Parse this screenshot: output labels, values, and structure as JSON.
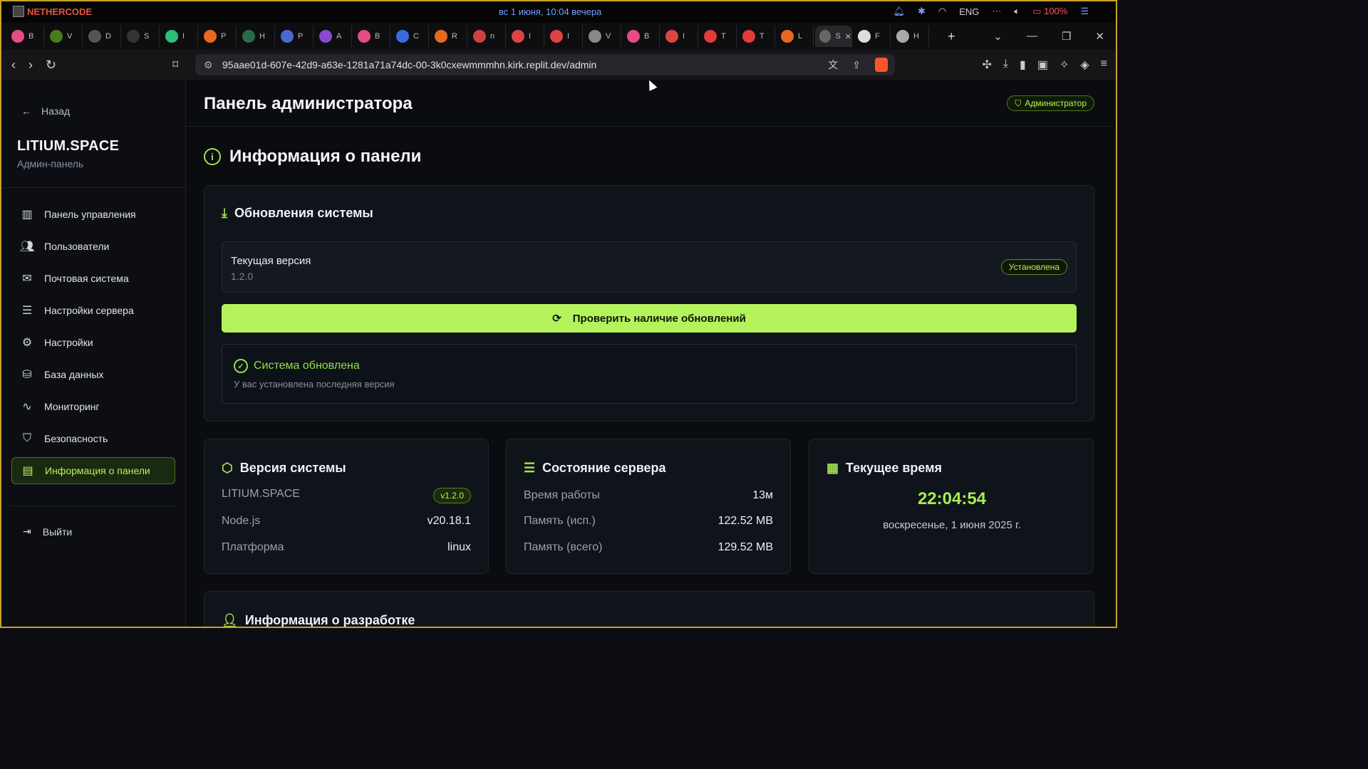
{
  "os": {
    "app_name": "NETHERCODE",
    "clock": "вс 1 июня, 10:04 вечера",
    "lang": "ENG",
    "battery": "100%"
  },
  "tabs": [
    {
      "label": "B",
      "color": "#e44d83"
    },
    {
      "label": "V",
      "color": "#4a7a20"
    },
    {
      "label": "D",
      "color": "#555"
    },
    {
      "label": "S",
      "color": "#333"
    },
    {
      "label": "I",
      "color": "#2bbf7a"
    },
    {
      "label": "P",
      "color": "#e86a1f"
    },
    {
      "label": "H",
      "color": "#2a6a4a"
    },
    {
      "label": "P",
      "color": "#4a6ad0"
    },
    {
      "label": "A",
      "color": "#8a4ad0"
    },
    {
      "label": "B",
      "color": "#e44d83"
    },
    {
      "label": "C",
      "color": "#3a6ae0"
    },
    {
      "label": "R",
      "color": "#e86a1f"
    },
    {
      "label": "n",
      "color": "#d04040"
    },
    {
      "label": "I",
      "color": "#d44"
    },
    {
      "label": "I",
      "color": "#d44"
    },
    {
      "label": "V",
      "color": "#888"
    },
    {
      "label": "B",
      "color": "#e44d83"
    },
    {
      "label": "I",
      "color": "#d44"
    },
    {
      "label": "T",
      "color": "#e23b3b"
    },
    {
      "label": "T",
      "color": "#e23b3b"
    },
    {
      "label": "L",
      "color": "#e86a1f"
    },
    {
      "label": "S",
      "color": "#666"
    },
    {
      "label": "F",
      "color": "#ddd"
    },
    {
      "label": "H",
      "color": "#aaa"
    }
  ],
  "browser": {
    "url": "95aae01d-607e-42d9-a63e-1281a71a74dc-00-3k0cxewmmmhn.kirk.replit.dev/admin"
  },
  "sidebar": {
    "back_label": "Назад",
    "brand": "LITIUM.SPACE",
    "brand_sub": "Админ-панель",
    "items": [
      {
        "label": "Панель управления",
        "icon": "bar-chart-icon"
      },
      {
        "label": "Пользователи",
        "icon": "users-icon"
      },
      {
        "label": "Почтовая система",
        "icon": "mail-icon"
      },
      {
        "label": "Настройки сервера",
        "icon": "server-icon"
      },
      {
        "label": "Настройки",
        "icon": "gear-icon"
      },
      {
        "label": "База данных",
        "icon": "database-icon"
      },
      {
        "label": "Мониторинг",
        "icon": "activity-icon"
      },
      {
        "label": "Безопасность",
        "icon": "shield-icon"
      },
      {
        "label": "Информация о панели",
        "icon": "file-icon"
      }
    ],
    "logout_label": "Выйти"
  },
  "header": {
    "title": "Панель администратора",
    "role_badge": "Администратор"
  },
  "section": {
    "title": "Информация о панели"
  },
  "updates": {
    "title": "Обновления системы",
    "current_label": "Текущая версия",
    "current_value": "1.2.0",
    "installed_badge": "Установлена",
    "check_button": "Проверить наличие обновлений",
    "status_title": "Система обновлена",
    "status_desc": "У вас установлена последняя версия"
  },
  "version_card": {
    "title": "Версия системы",
    "rows": [
      {
        "key": "LITIUM.SPACE",
        "value": "v1.2.0"
      },
      {
        "key": "Node.js",
        "value": "v20.18.1"
      },
      {
        "key": "Платформа",
        "value": "linux"
      }
    ]
  },
  "server_card": {
    "title": "Состояние сервера",
    "rows": [
      {
        "key": "Время работы",
        "value": "13м"
      },
      {
        "key": "Память (исп.)",
        "value": "122.52 MB"
      },
      {
        "key": "Память (всего)",
        "value": "129.52 MB"
      }
    ]
  },
  "time_card": {
    "title": "Текущее время",
    "time": "22:04:54",
    "date": "воскресенье, 1 июня 2025 г."
  },
  "dev_card": {
    "title": "Информация о разработке"
  },
  "colors": {
    "accent": "#b4f35c",
    "background": "#0a0c10",
    "card": "#0f131a"
  }
}
